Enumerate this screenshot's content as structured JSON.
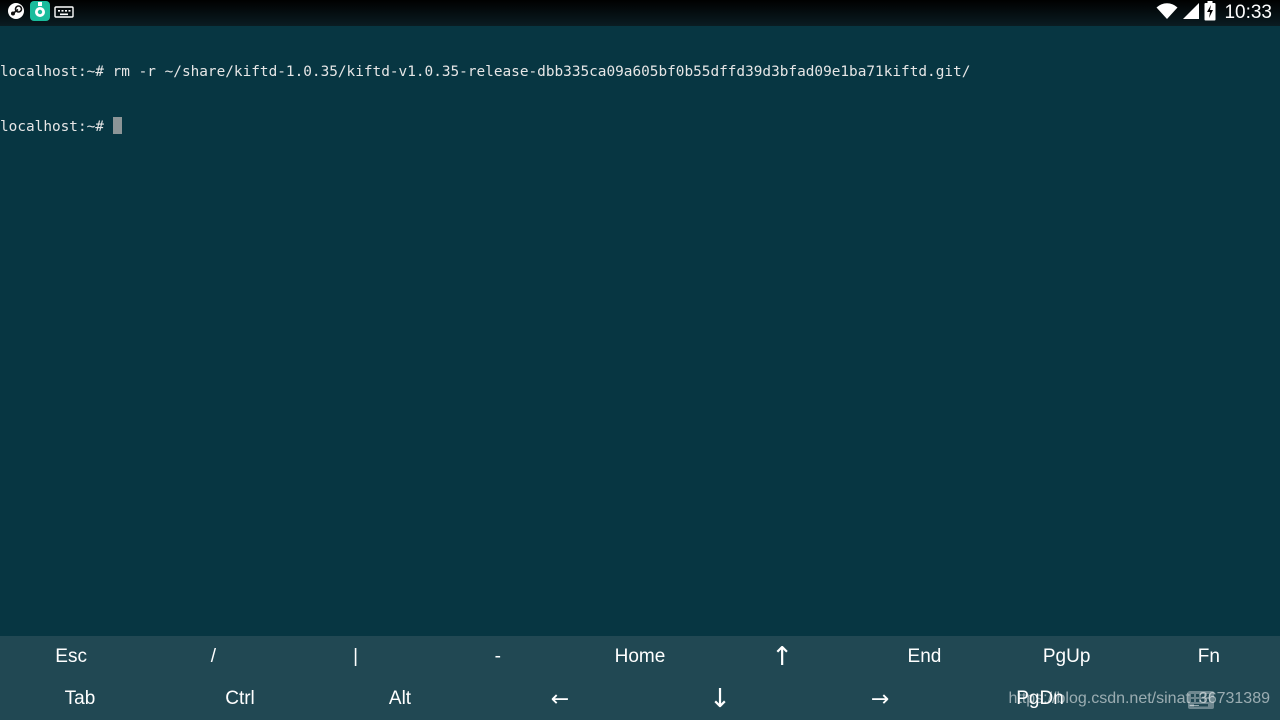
{
  "status_bar": {
    "time": "10:33",
    "notification_icons": [
      "steam-app-icon",
      "linux-deploy-icon",
      "keyboard-icon"
    ],
    "indicators": [
      "wifi-icon",
      "signal-icon",
      "battery-charging-icon"
    ]
  },
  "terminal": {
    "lines": [
      "localhost:~# rm -r ~/share/kiftd-1.0.35/kiftd-v1.0.35-release-dbb335ca09a605bf0b55dffd39d3bfad09e1ba71kiftd.git/",
      "localhost:~# "
    ],
    "colors": {
      "background": "#073642",
      "foreground": "#e6e6e6",
      "cursor": "#8c9597"
    }
  },
  "extra_keys": {
    "row1": [
      "Esc",
      "/",
      "|",
      "-",
      "Home",
      "↑",
      "End",
      "PgUp",
      "Fn"
    ],
    "row2": [
      "Tab",
      "Ctrl",
      "Alt",
      "←",
      "↓",
      "→",
      "PgDn",
      ""
    ],
    "background": "#214853"
  },
  "watermark": {
    "text": "https://blog.csdn.net/sinat_36731389"
  }
}
